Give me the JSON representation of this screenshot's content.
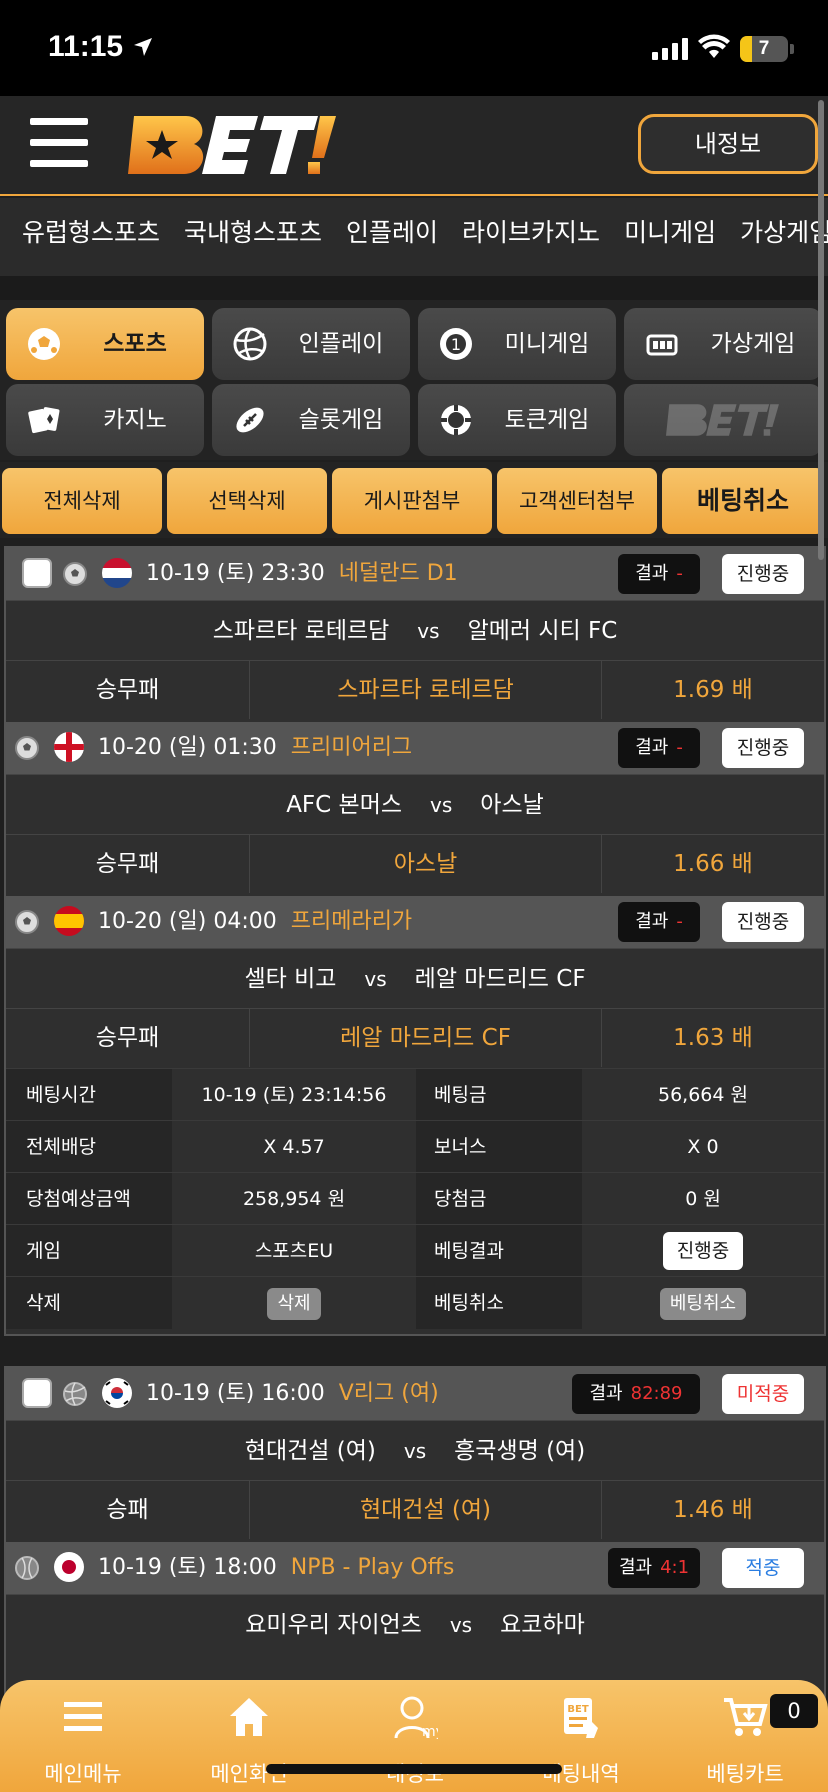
{
  "status_bar": {
    "time": "11:15",
    "battery": "7"
  },
  "header": {
    "logo_text": "BET!",
    "my_info_label": "내정보"
  },
  "categories": [
    "유럽형스포츠",
    "국내형스포츠",
    "인플레이",
    "라이브카지노",
    "미니게임",
    "가상게임"
  ],
  "game_buttons": [
    {
      "label": "스포츠",
      "icon": "soccer-ball-icon",
      "active": true
    },
    {
      "label": "인플레이",
      "icon": "volleyball-icon"
    },
    {
      "label": "미니게임",
      "icon": "mini-game-icon"
    },
    {
      "label": "가상게임",
      "icon": "virtual-game-icon"
    },
    {
      "label": "카지노",
      "icon": "cards-icon"
    },
    {
      "label": "슬롯게임",
      "icon": "football-icon"
    },
    {
      "label": "토큰게임",
      "icon": "token-chip-icon"
    },
    {
      "label": "BET!",
      "icon": "logo"
    }
  ],
  "actions": {
    "delete_all": "전체삭제",
    "delete_selected": "선택삭제",
    "attach_board": "게시판첨부",
    "attach_support": "고객센터첨부",
    "cancel_bet": "베팅취소"
  },
  "slip1": {
    "matches": [
      {
        "date": "10-19 (토) 23:30",
        "league": "네덜란드 D1",
        "result_label": "결과",
        "result_value": "-",
        "status": "진행중",
        "home": "스파르타 로테르담",
        "away": "알메러 시티 FC",
        "vs": "vs",
        "market": "승무패",
        "pick": "스파르타 로테르담",
        "odds": "1.69 배"
      },
      {
        "date": "10-20 (일) 01:30",
        "league": "프리미어리그",
        "result_label": "결과",
        "result_value": "-",
        "status": "진행중",
        "home": "AFC 본머스",
        "away": "아스날",
        "vs": "vs",
        "market": "승무패",
        "pick": "아스날",
        "odds": "1.66 배"
      },
      {
        "date": "10-20 (일) 04:00",
        "league": "프리메라리가",
        "result_label": "결과",
        "result_value": "-",
        "status": "진행중",
        "home": "셀타 비고",
        "away": "레알 마드리드 CF",
        "vs": "vs",
        "market": "승무패",
        "pick": "레알 마드리드 CF",
        "odds": "1.63 배"
      }
    ],
    "info": {
      "bet_time_label": "베팅시간",
      "bet_time": "10-19 (토) 23:14:56",
      "bet_amount_label": "베팅금",
      "bet_amount": "56,664 원",
      "total_odds_label": "전체배당",
      "total_odds": "X 4.57",
      "bonus_label": "보너스",
      "bonus": "X 0",
      "expected_label": "당첨예상금액",
      "expected": "258,954 원",
      "win_label": "당첨금",
      "win": "0 원",
      "game_label": "게임",
      "game": "스포츠EU",
      "result_label": "베팅결과",
      "result": "진행중",
      "delete_label": "삭제",
      "delete_btn": "삭제",
      "cancel_label": "베팅취소",
      "cancel_btn": "베팅취소"
    }
  },
  "slip2": {
    "matches": [
      {
        "date": "10-19 (토) 16:00",
        "league": "V리그 (여)",
        "result_label": "결과",
        "result_value": "82:89",
        "status": "미적중",
        "home": "현대건설 (여)",
        "away": "흥국생명 (여)",
        "vs": "vs",
        "market": "승패",
        "pick": "현대건설 (여)",
        "odds": "1.46 배"
      },
      {
        "date": "10-19 (토) 18:00",
        "league": "NPB - Play Offs",
        "result_label": "결과",
        "result_value": "4:1",
        "status": "적중",
        "home": "요미우리 자이언츠",
        "away": "요코하마",
        "vs": "vs"
      }
    ]
  },
  "bottom_nav": [
    {
      "label": "메인메뉴",
      "icon": "menu-icon"
    },
    {
      "label": "메인화면",
      "icon": "home-icon"
    },
    {
      "label": "내정보",
      "icon": "profile-icon"
    },
    {
      "label": "베팅내역",
      "icon": "bet-history-icon"
    },
    {
      "label": "베팅카트",
      "icon": "cart-icon"
    }
  ],
  "cart_count": "0",
  "colors": {
    "accent": "#f0a63c",
    "background": "#1f1f1f",
    "lose": "#e33333",
    "win": "#2a7de1"
  }
}
